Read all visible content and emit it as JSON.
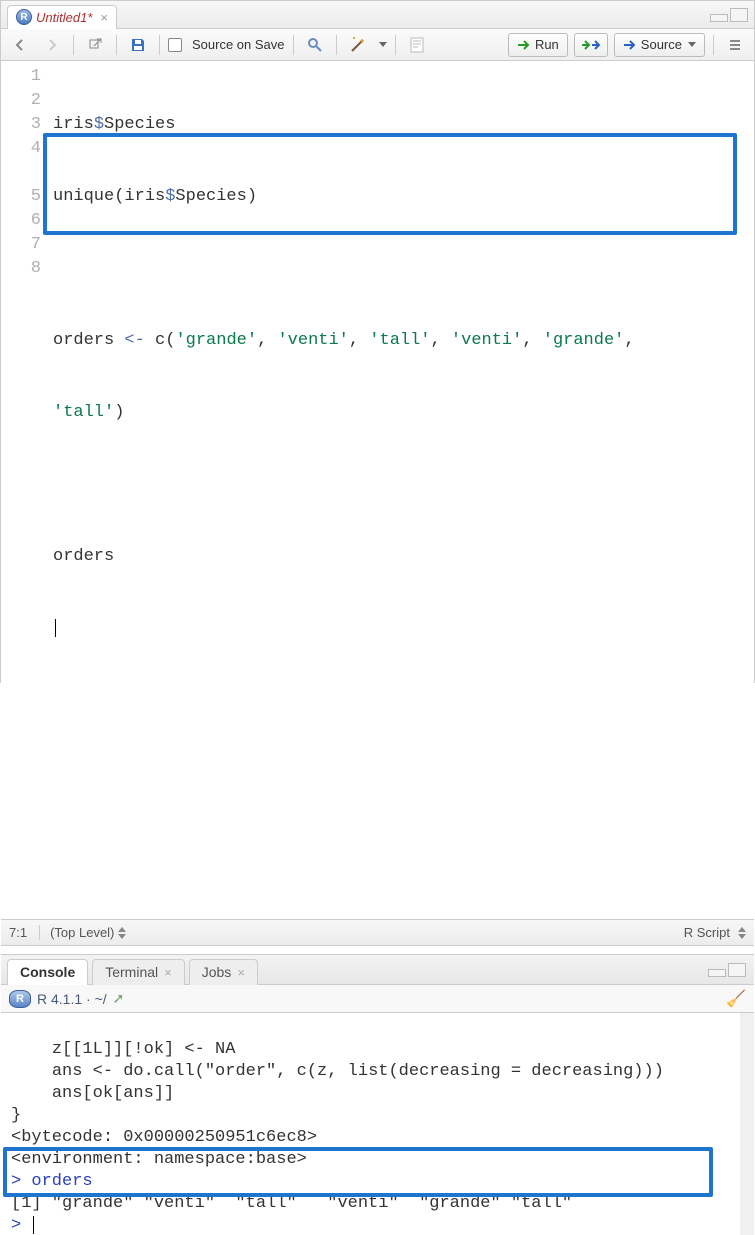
{
  "editor": {
    "tab_title": "Untitled1*",
    "toolbar": {
      "source_on_save_label": "Source on Save",
      "run_label": "Run",
      "source_label": "Source"
    },
    "lines": [
      "1",
      "2",
      "3",
      "4",
      "5",
      "6",
      "7",
      "8"
    ],
    "code": {
      "l1_a": "iris",
      "l1_op": "$",
      "l1_b": "Species",
      "l2_a": "unique(iris",
      "l2_op": "$",
      "l2_b": "Species)",
      "l4_a": "orders ",
      "l4_op": "<-",
      "l4_b": " c(",
      "l4_s1": "'grande'",
      "l4_c1": ", ",
      "l4_s2": "'venti'",
      "l4_c2": ", ",
      "l4_s3": "'tall'",
      "l4_c3": ", ",
      "l4_s4": "'venti'",
      "l4_c4": ", ",
      "l4_s5": "'grande'",
      "l4_c5": ",",
      "l4w_s6": "'tall'",
      "l4w_b": ")",
      "l6": "orders"
    },
    "status": {
      "pos": "7:1",
      "scope": "(Top Level)",
      "lang": "R Script"
    }
  },
  "console": {
    "tabs": {
      "console": "Console",
      "terminal": "Terminal",
      "jobs": "Jobs"
    },
    "info": "R 4.1.1 · ~/",
    "body": {
      "line1": "    z[[1L]][!ok] <- NA",
      "line2": "    ans <- do.call(\"order\", c(z, list(decreasing = decreasing)))",
      "line3": "    ans[ok[ans]]",
      "line4": "}",
      "line5": "<bytecode: 0x00000250951c6ec8>",
      "line6": "<environment: namespace:base>",
      "prompt1": "> ",
      "cmd1": "orders",
      "out1": "[1] \"grande\" \"venti\"  \"tall\"   \"venti\"  \"grande\" \"tall\"  ",
      "prompt2": "> "
    }
  }
}
